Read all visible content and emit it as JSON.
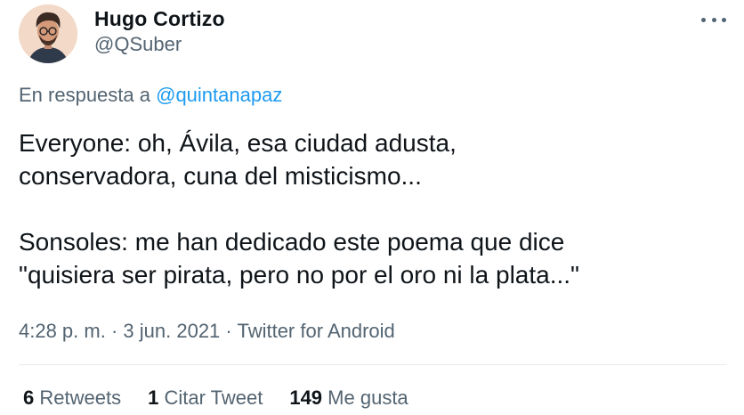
{
  "author": {
    "display_name": "Hugo Cortizo",
    "handle": "@QSuber"
  },
  "reply": {
    "prefix": "En respuesta a",
    "mention": "@quintanapaz"
  },
  "tweet": {
    "line1": "Everyone: oh, Ávila, esa ciudad adusta,",
    "line2": "conservadora, cuna del misticismo...",
    "line3": "Sonsoles: me han dedicado este poema que dice",
    "line4": "\"quisiera ser pirata, pero no por el oro ni la plata...\""
  },
  "meta": {
    "time": "4:28 p. m.",
    "separator1": "·",
    "date": "3 jun. 2021",
    "separator2": "·",
    "source": "Twitter for Android"
  },
  "stats": {
    "retweets_count": "6",
    "retweets_label": "Retweets",
    "quotes_count": "1",
    "quotes_label": "Citar Tweet",
    "likes_count": "149",
    "likes_label": "Me gusta"
  },
  "icons": {
    "more": "more-options-icon"
  },
  "colors": {
    "link": "#1d9bf0",
    "secondary_text": "#536471",
    "primary_text": "#0f1419"
  }
}
